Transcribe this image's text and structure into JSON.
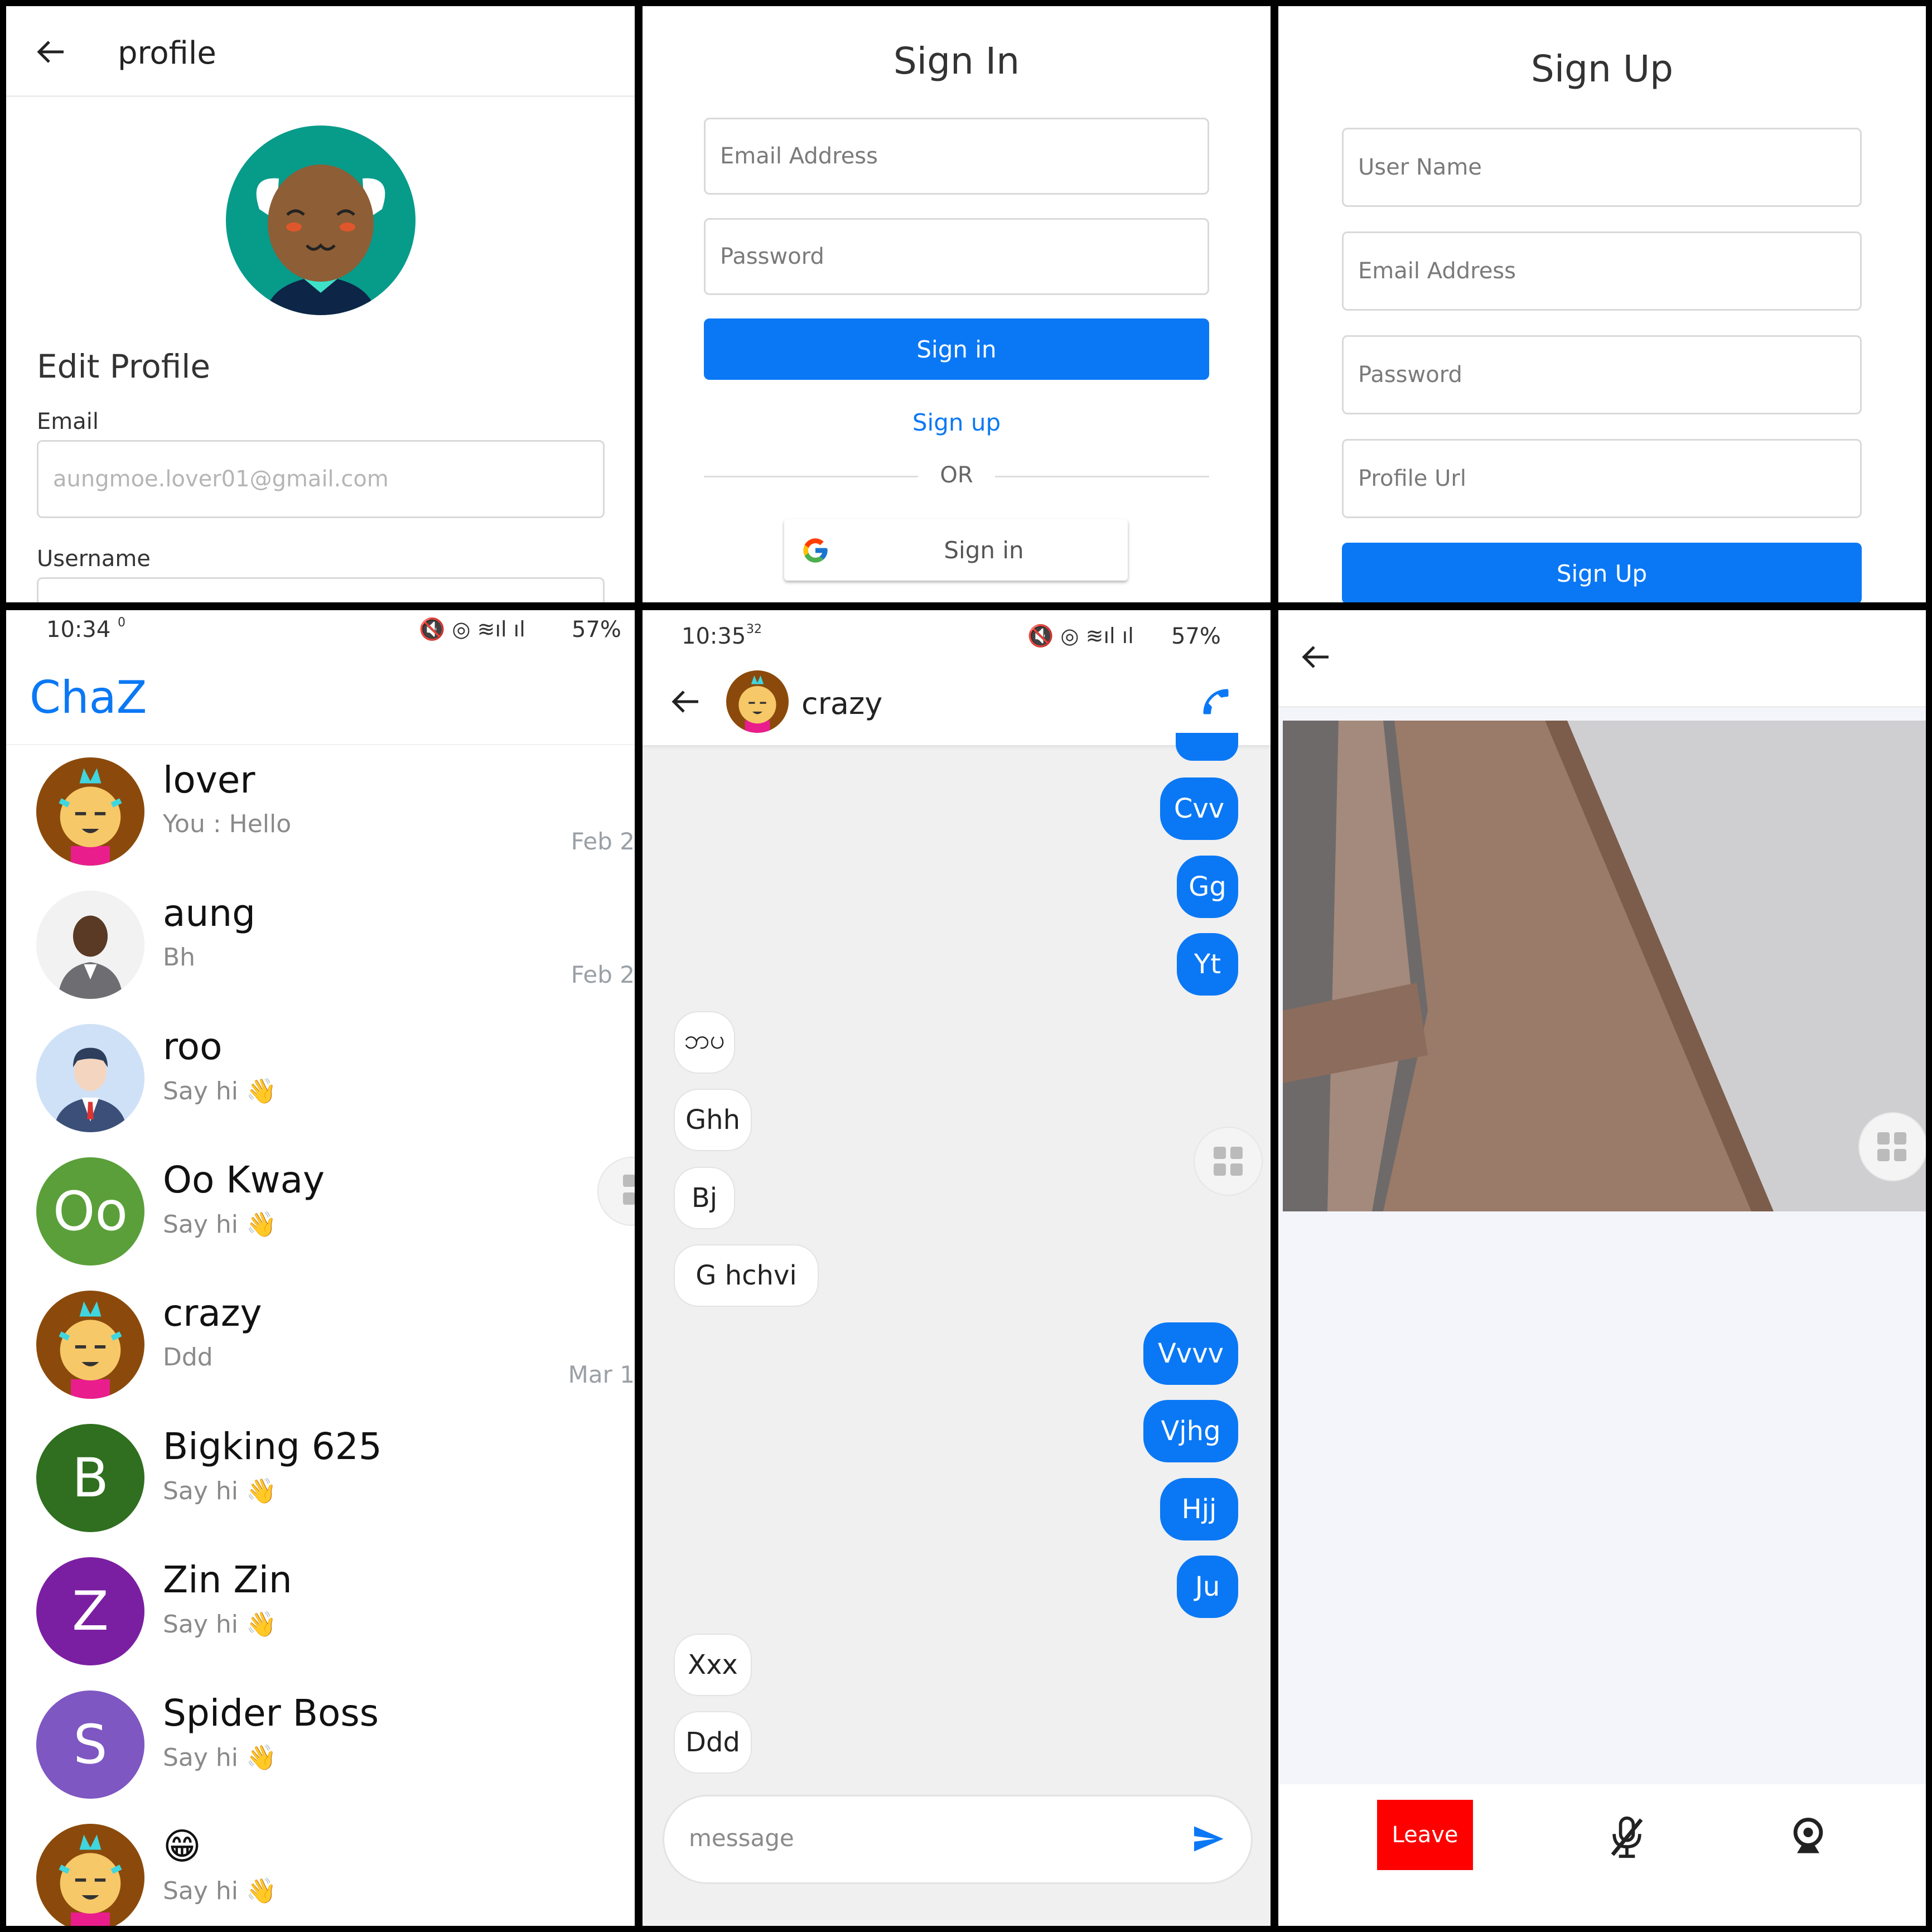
{
  "profile": {
    "header_title": "profile",
    "section_title": "Edit Profile",
    "email_label": "Email",
    "email_placeholder": "aungmoe.lover01@gmail.com",
    "username_label": "Username"
  },
  "signin": {
    "title": "Sign In",
    "email_placeholder": "Email Address",
    "password_placeholder": "Password",
    "signin_button": "Sign in",
    "signup_link": "Sign up",
    "or_text": "OR",
    "google_button": "Sign in"
  },
  "signup": {
    "title": "Sign Up",
    "username_placeholder": "User Name",
    "email_placeholder": "Email Address",
    "password_placeholder": "Password",
    "profile_url_placeholder": "Profile Url",
    "signup_button": "Sign Up"
  },
  "chatlist": {
    "status": {
      "time": "10:34",
      "net": "0",
      "battery": "57%"
    },
    "app_title": "ChaZ",
    "chats": [
      {
        "name": "lover",
        "last": "You : Hello",
        "date": "Feb 2",
        "avatar": "cartoon",
        "color": "#8B4A0B"
      },
      {
        "name": "aung",
        "last": "Bh",
        "date": "Feb 2",
        "avatar": "photo",
        "color": "#ececec"
      },
      {
        "name": "roo",
        "last": "Say hi 👋",
        "date": "",
        "avatar": "man",
        "color": "#cfe1f7"
      },
      {
        "name": "Oo Kway",
        "last": "Say hi 👋",
        "date": "",
        "avatar": "letters",
        "letters": "Oo",
        "color": "#5b9f3a"
      },
      {
        "name": "crazy",
        "last": "Ddd",
        "date": "Mar 1",
        "avatar": "cartoon",
        "color": "#8B4A0B"
      },
      {
        "name": "Bigking 625",
        "last": "Say hi 👋",
        "date": "",
        "avatar": "letters",
        "letters": "B",
        "color": "#2f6f1f"
      },
      {
        "name": "Zin Zin",
        "last": "Say hi 👋",
        "date": "",
        "avatar": "letters",
        "letters": "Z",
        "color": "#7b1fa2"
      },
      {
        "name": "Spider Boss",
        "last": "Say hi 👋",
        "date": "",
        "avatar": "letters",
        "letters": "S",
        "color": "#7e57c2"
      },
      {
        "name": "😁",
        "last": "Say hi 👋",
        "date": "",
        "avatar": "cartoon",
        "color": "#8B4A0B"
      }
    ]
  },
  "chat": {
    "status": {
      "time": "10:35",
      "net": "32",
      "battery": "57%"
    },
    "contact_name": "crazy",
    "messages": [
      {
        "text": "Cvv",
        "dir": "out"
      },
      {
        "text": "Gg",
        "dir": "out"
      },
      {
        "text": "Yt",
        "dir": "out"
      },
      {
        "text": "ဘပ",
        "dir": "in"
      },
      {
        "text": "Ghh",
        "dir": "in"
      },
      {
        "text": "Bj",
        "dir": "in"
      },
      {
        "text": "G hchvi",
        "dir": "in"
      },
      {
        "text": "Vvvv",
        "dir": "out"
      },
      {
        "text": "Vjhg",
        "dir": "out"
      },
      {
        "text": "Hjj",
        "dir": "out"
      },
      {
        "text": "Ju",
        "dir": "out"
      },
      {
        "text": "Xxx",
        "dir": "in"
      },
      {
        "text": "Ddd",
        "dir": "in"
      }
    ],
    "input_placeholder": "message"
  },
  "call": {
    "leave_button": "Leave",
    "colors": {
      "leave": "#ff0000"
    }
  },
  "colors": {
    "accent": "#0a78f5"
  }
}
